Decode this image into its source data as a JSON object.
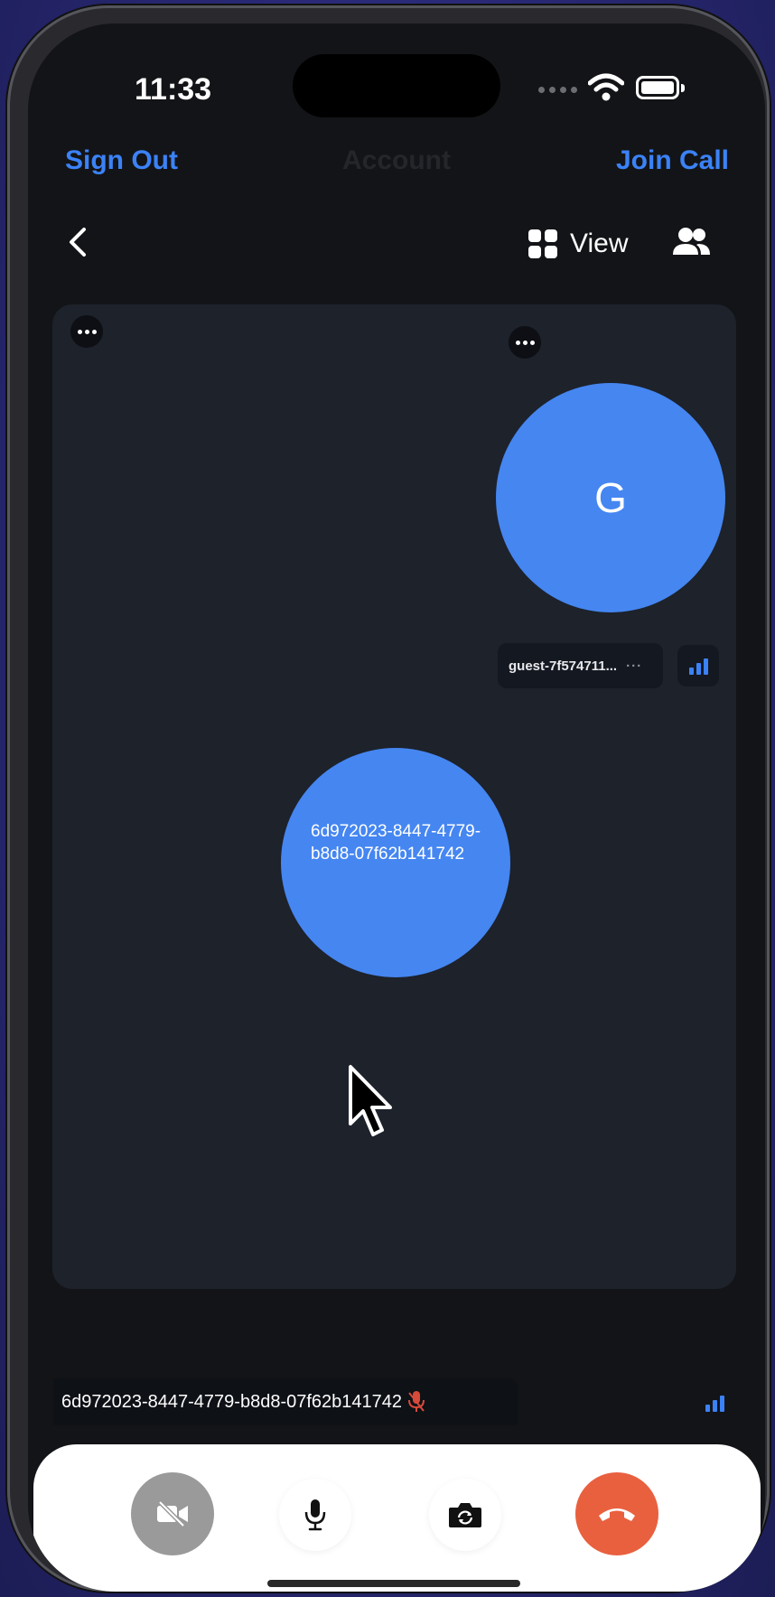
{
  "status_bar": {
    "time": "11:33"
  },
  "nav": {
    "left_link": "Sign Out",
    "title": "Account",
    "right_link": "Join Call"
  },
  "call_header": {
    "view_label": "View",
    "icons": [
      "back-chevron-icon",
      "grid-layout-icon",
      "participants-icon"
    ]
  },
  "participants": {
    "remote": {
      "initial": "G",
      "name": "guest-7f574711...",
      "name_menu": "···"
    },
    "local": {
      "avatar_text": "6d972023-8447-4779-b8d8-07f62b141742",
      "name": "6d972023-8447-4779-b8d8-07f62b141742",
      "mic_muted": true
    }
  },
  "controls": {
    "buttons": [
      "video-off-icon",
      "microphone-icon",
      "camera-flip-icon",
      "end-call-icon"
    ],
    "end_call_color": "#e9603f",
    "video_off_color": "#9a9a9a"
  },
  "colors": {
    "accent": "#3b82f6",
    "avatar": "#4586f1",
    "stage": "#1d222b"
  }
}
